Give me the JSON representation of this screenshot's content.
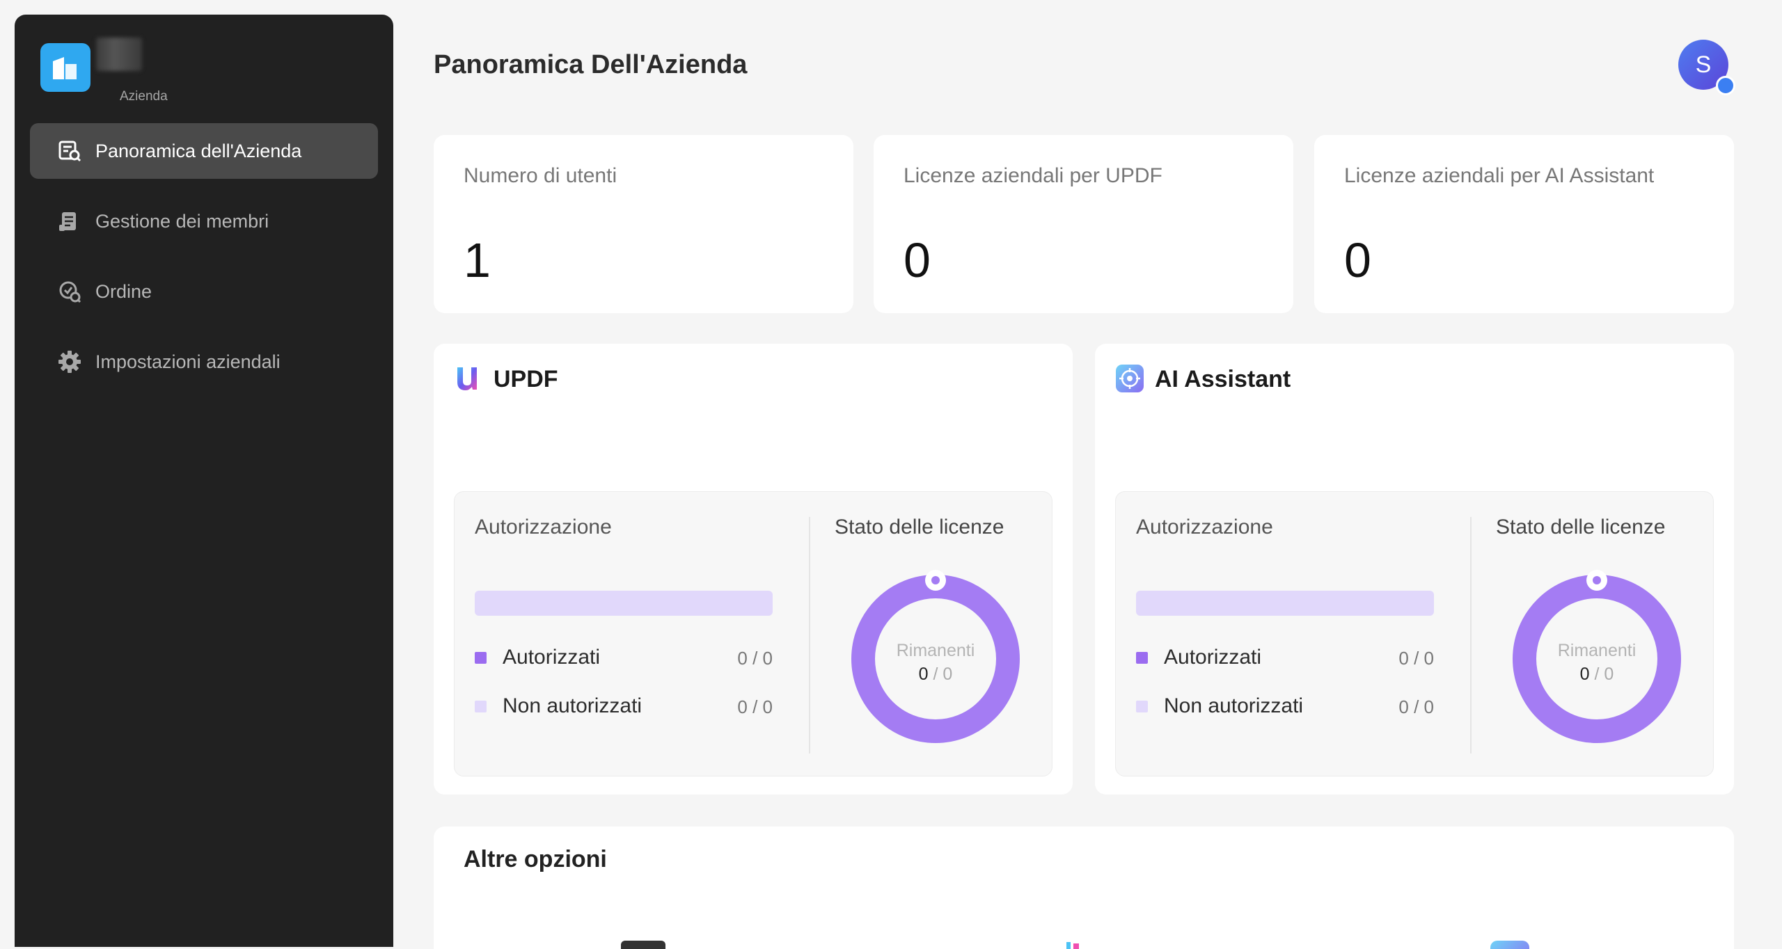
{
  "sidebar": {
    "logo_subtitle": "Azienda",
    "items": [
      {
        "label": "Panoramica dell'Azienda",
        "icon": "overview-icon",
        "active": true
      },
      {
        "label": "Gestione dei membri",
        "icon": "members-icon",
        "active": false
      },
      {
        "label": "Ordine",
        "icon": "order-icon",
        "active": false
      },
      {
        "label": "Impostazioni aziendali",
        "icon": "gear-icon",
        "active": false
      }
    ]
  },
  "header": {
    "title": "Panoramica Dell'Azienda",
    "avatar_letter": "S"
  },
  "stats": [
    {
      "label": "Numero di utenti",
      "value": "1"
    },
    {
      "label": "Licenze aziendali per UPDF",
      "value": "0"
    },
    {
      "label": "Licenze aziendali per AI Assistant",
      "value": "0"
    }
  ],
  "products": [
    {
      "title": "UPDF",
      "icon": "updf-logo-icon",
      "auth_title": "Autorizzazione",
      "authorized_label": "Autorizzati",
      "authorized_count": "0 / 0",
      "unauthorized_label": "Non autorizzati",
      "unauthorized_count": "0 / 0",
      "status_title": "Stato delle licenze",
      "remaining_label": "Rimanenti",
      "remaining_value": "0",
      "remaining_total": "/ 0"
    },
    {
      "title": "AI Assistant",
      "icon": "ai-assistant-icon",
      "auth_title": "Autorizzazione",
      "authorized_label": "Autorizzati",
      "authorized_count": "0 / 0",
      "unauthorized_label": "Non autorizzati",
      "unauthorized_count": "0 / 0",
      "status_title": "Stato delle licenze",
      "remaining_label": "Rimanenti",
      "remaining_value": "0",
      "remaining_total": "/ 0"
    }
  ],
  "more_options": {
    "title": "Altre opzioni"
  },
  "colors": {
    "sidebar_bg": "#212121",
    "accent_purple": "#a47cf3",
    "authorized_swatch": "#9b6cf0",
    "unauthorized_swatch": "#e1d8fb",
    "logo_blue": "#2fa8f0"
  }
}
